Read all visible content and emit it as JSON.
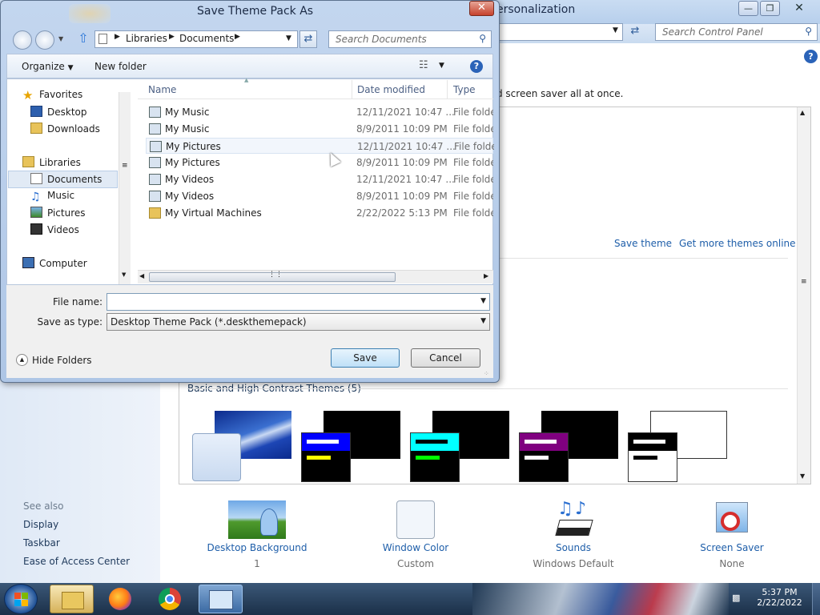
{
  "background_window": {
    "title": "ersonalization",
    "search_placeholder": "Search Control Panel",
    "description": "d screen saver all at once.",
    "save_theme": "Save theme",
    "get_more_themes": "Get more themes online",
    "basic_section": "Basic and High Contrast Themes (5)",
    "see_also": {
      "heading": "See also",
      "links": [
        "Display",
        "Taskbar",
        "Ease of Access Center"
      ]
    },
    "bottom_items": [
      {
        "label": "Desktop Background",
        "sub": "1"
      },
      {
        "label": "Window Color",
        "sub": "Custom"
      },
      {
        "label": "Sounds",
        "sub": "Windows Default"
      },
      {
        "label": "Screen Saver",
        "sub": "None"
      }
    ]
  },
  "dialog": {
    "title": "Save Theme Pack As",
    "breadcrumb": [
      "Libraries",
      "Documents"
    ],
    "search_placeholder": "Search Documents",
    "toolbar": {
      "organize": "Organize",
      "new_folder": "New folder"
    },
    "nav": {
      "favorites": "Favorites",
      "desktop": "Desktop",
      "downloads": "Downloads",
      "libraries": "Libraries",
      "documents": "Documents",
      "music": "Music",
      "pictures": "Pictures",
      "videos": "Videos",
      "computer": "Computer"
    },
    "columns": {
      "name": "Name",
      "date": "Date modified",
      "type": "Type"
    },
    "files": [
      {
        "name": "My Music",
        "date": "12/11/2021 10:47 ...",
        "type": "File folder"
      },
      {
        "name": "My Music",
        "date": "8/9/2011 10:09 PM",
        "type": "File folder"
      },
      {
        "name": "My Pictures",
        "date": "12/11/2021 10:47 ...",
        "type": "File folder"
      },
      {
        "name": "My Pictures",
        "date": "8/9/2011 10:09 PM",
        "type": "File folder"
      },
      {
        "name": "My Videos",
        "date": "12/11/2021 10:47 ...",
        "type": "File folder"
      },
      {
        "name": "My Videos",
        "date": "8/9/2011 10:09 PM",
        "type": "File folder"
      },
      {
        "name": "My Virtual Machines",
        "date": "2/22/2022 5:13 PM",
        "type": "File folder"
      }
    ],
    "file_name_label": "File name:",
    "file_name_value": "",
    "save_type_label": "Save as type:",
    "save_type_value": "Desktop Theme Pack (*.deskthemepack)",
    "hide_folders": "Hide Folders",
    "save": "Save",
    "cancel": "Cancel"
  },
  "taskbar": {
    "time": "5:37 PM",
    "date": "2/22/2022"
  }
}
